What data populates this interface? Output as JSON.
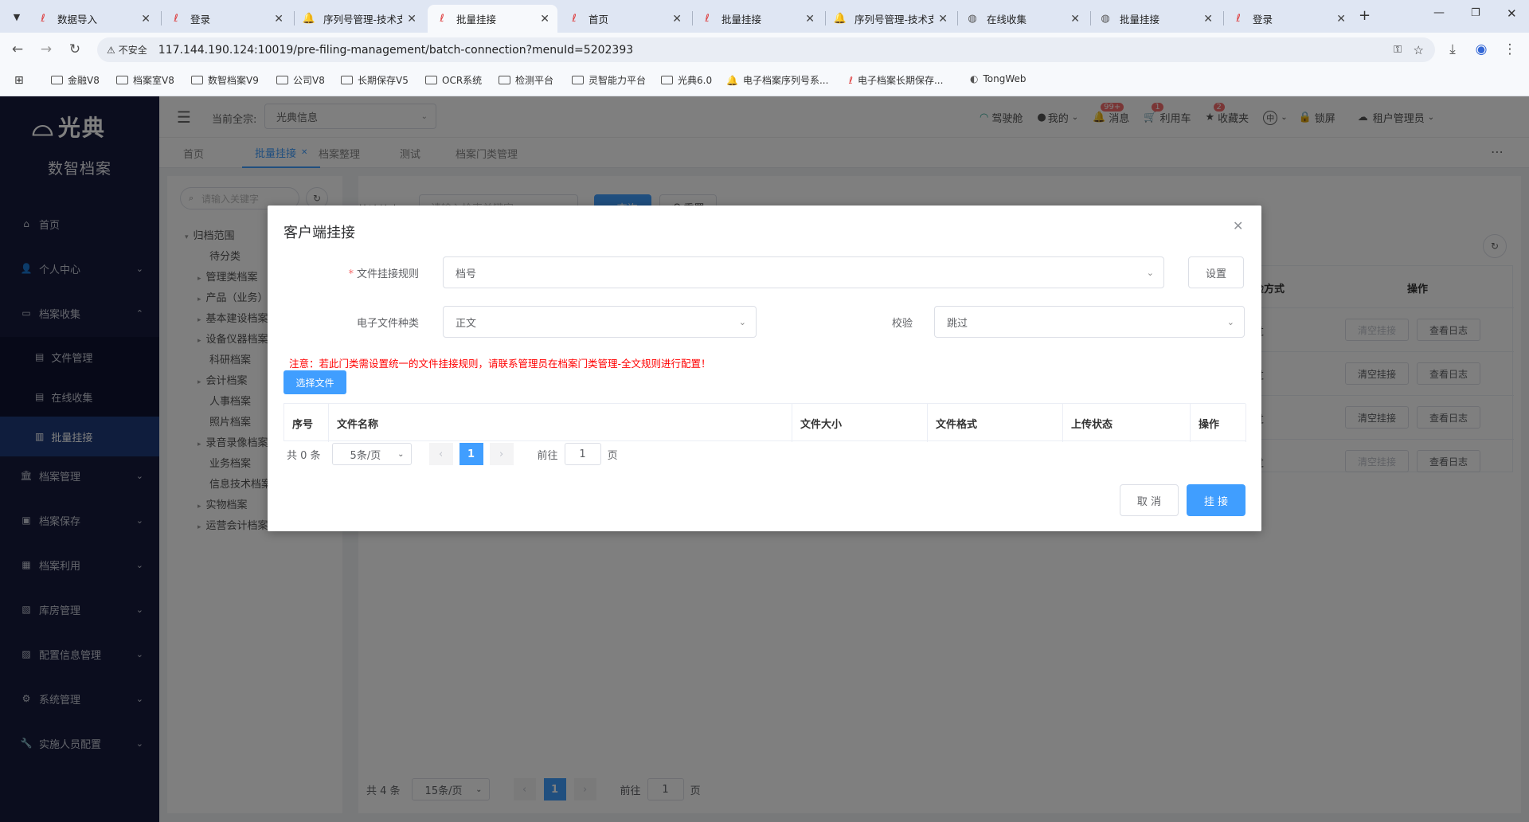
{
  "browser": {
    "tabs": [
      {
        "title": "数据导入",
        "icon": "app-logo-icon"
      },
      {
        "title": "登录",
        "icon": "app-logo-icon"
      },
      {
        "title": "序列号管理-技术支持",
        "icon": "bell-icon"
      },
      {
        "title": "批量挂接",
        "icon": "app-logo-icon",
        "active": true
      },
      {
        "title": "首页",
        "icon": "app-logo-icon"
      },
      {
        "title": "批量挂接",
        "icon": "app-logo-icon"
      },
      {
        "title": "序列号管理-技术支持",
        "icon": "bell-icon"
      },
      {
        "title": "在线收集",
        "icon": "globe-icon"
      },
      {
        "title": "批量挂接",
        "icon": "globe-icon"
      },
      {
        "title": "登录",
        "icon": "app-logo-icon"
      }
    ],
    "new_tab": "+",
    "security_label": "不安全",
    "url": "117.144.190.124:10019/pre-filing-management/batch-connection?menuId=5202393",
    "bookmarks": [
      "金融V8",
      "档案室V8",
      "数智档案V9",
      "公司V8",
      "长期保存V5",
      "OCR系统",
      "检测平台",
      "灵智能力平台",
      "光典6.0",
      "电子档案序列号系...",
      "电子档案长期保存...",
      "TongWeb"
    ]
  },
  "app": {
    "logo_text": "光典",
    "subtitle": "数智档案",
    "menu": [
      {
        "label": "首页",
        "icon": "home-icon"
      },
      {
        "label": "个人中心",
        "icon": "user-icon",
        "arrow": true
      },
      {
        "label": "档案收集",
        "icon": "folder-icon",
        "arrow": true,
        "expanded": true
      }
    ],
    "submenu": [
      {
        "label": "文件管理",
        "icon": "document-icon"
      },
      {
        "label": "在线收集",
        "icon": "document-icon"
      },
      {
        "label": "批量挂接",
        "icon": "chart-icon",
        "active": true
      }
    ],
    "menu_after": [
      {
        "label": "档案管理",
        "icon": "building-icon"
      },
      {
        "label": "档案保存",
        "icon": "save-icon"
      },
      {
        "label": "档案利用",
        "icon": "clipboard-icon"
      },
      {
        "label": "库房管理",
        "icon": "warehouse-icon"
      },
      {
        "label": "配置信息管理",
        "icon": "config-icon"
      },
      {
        "label": "系统管理",
        "icon": "gear-icon"
      },
      {
        "label": "实施人员配置",
        "icon": "wrench-icon"
      }
    ],
    "header": {
      "fonds_label": "当前全宗:",
      "fonds_value": "光典信息",
      "cockpit": "驾驶舱",
      "mine": "我的",
      "messages": "消息",
      "messages_badge": "99+",
      "cart": "利用车",
      "cart_badge": "1",
      "favorites": "收藏夹",
      "favorites_badge": "2",
      "lang": "中",
      "lock": "锁屏",
      "user": "租户管理员"
    },
    "tags": [
      "首页",
      "批量挂接",
      "档案整理",
      "测试",
      "档案门类管理"
    ],
    "tree_search_placeholder": "请输入关键字",
    "tree": [
      "归档范围",
      "待分类",
      "管理类档案",
      "产品（业务）",
      "基本建设档案",
      "设备仪器档案",
      "科研档案",
      "会计档案",
      "人事档案",
      "照片档案",
      "录音录像档案",
      "业务档案",
      "信息技术档案",
      "实物档案",
      "运营会计档案"
    ],
    "quick_search_label": "快速检索",
    "quick_search_placeholder": "请输入检索关键字",
    "search_btn": "查询",
    "reset_btn": "重置",
    "bg_table": {
      "headers": [
        "检验方式",
        "操作"
      ],
      "rows": [
        {
          "check": "跳过",
          "clear": "清空挂接",
          "log": "查看日志",
          "clear_disabled": true
        },
        {
          "check": "跳过",
          "clear": "清空挂接",
          "log": "查看日志",
          "clear_disabled": false
        },
        {
          "check": "跳过",
          "clear": "清空挂接",
          "log": "查看日志",
          "clear_disabled": false
        },
        {
          "check": "跳过",
          "clear": "清空挂接",
          "log": "查看日志",
          "clear_disabled": true
        }
      ]
    },
    "bg_pagination": {
      "total": "共 4 条",
      "page_size": "15条/页",
      "page": "1",
      "goto": "前往",
      "goto_value": "1",
      "page_unit": "页"
    }
  },
  "dialog": {
    "title": "客户端挂接",
    "rule_label": "文件挂接规则",
    "rule_value": "档号",
    "settings_btn": "设置",
    "type_label": "电子文件种类",
    "type_value": "正文",
    "check_label": "校验",
    "check_value": "跳过",
    "notice": "注意：若此门类需设置统一的文件挂接规则，请联系管理员在档案门类管理-全文规则进行配置！",
    "select_file_btn": "选择文件",
    "columns": [
      "序号",
      "文件名称",
      "文件大小",
      "文件格式",
      "上传状态",
      "操作"
    ],
    "pagination": {
      "total": "共 0 条",
      "page_size": "5条/页",
      "page": "1",
      "goto": "前往",
      "goto_value": "1",
      "page_unit": "页"
    },
    "cancel_btn": "取 消",
    "confirm_btn": "挂 接"
  },
  "colors": {
    "primary": "#409eff",
    "sidebar": "#161b3d",
    "active_menu": "#1f3b7b",
    "danger": "#f56c6c"
  }
}
